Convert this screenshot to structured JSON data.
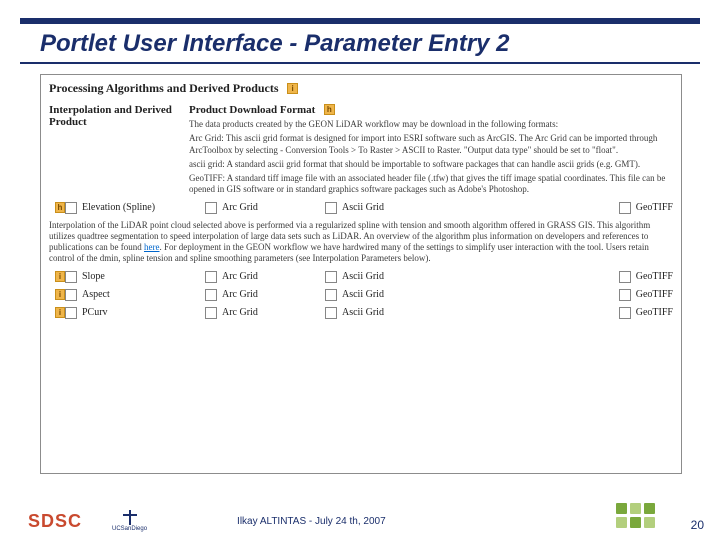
{
  "slide": {
    "title": "Portlet User Interface - Parameter Entry 2",
    "presenter": "Ilkay ALTINTAS - July 24 th, 2007",
    "page": "20",
    "sdsc": "SDSC",
    "ucsd": "UCSanDiego"
  },
  "panel": {
    "section": "Processing Algorithms and Derived Products",
    "left_heading": "Interpolation and Derived Product",
    "right_heading": "Product Download Format",
    "intro": "The data products created by the GEON LiDAR workflow may be download in the following formats:",
    "fmt_arc": "Arc Grid: This ascii grid format is designed for import into ESRI software such as ArcGIS. The Arc Grid can be imported through ArcToolbox by selecting - Conversion Tools > To Raster > ASCII to Raster. \"Output data type\" should be set to \"float\".",
    "fmt_ascii": "ascii grid: A standard ascii grid format that should be importable to software packages that can handle ascii grids (e.g. GMT).",
    "fmt_geotiff": "GeoTIFF: A standard tiff image file with an associated header file (.tfw) that gives the tiff image spatial coordinates. This file can be opened in GIS software or in standard graphics software packages such as Adobe's Photoshop.",
    "interp_desc_a": "Interpolation of the LiDAR point cloud selected above is performed via a regularized spline with tension and smooth algorithm offered in GRASS GIS. This algorithm utilizes quadtree segmentation to speed interpolation of large data sets such as LiDAR. An overview of the algorithm plus information on developers and references to publications can be found ",
    "here": "here",
    "interp_desc_b": ". For deployment in the GEON workflow we have hardwired many of the settings to simplify user interaction with the tool. Users retain control of the dmin, spline tension and spline smoothing parameters (see Interpolation Parameters below).",
    "products": {
      "elevation": "Elevation (Spline)",
      "slope": "Slope",
      "aspect": "Aspect",
      "pcurv": "PCurv"
    },
    "formats": {
      "arc": "Arc Grid",
      "ascii": "Ascii Grid",
      "geotiff": "GeoTIFF"
    },
    "info": "i",
    "help": "h"
  }
}
